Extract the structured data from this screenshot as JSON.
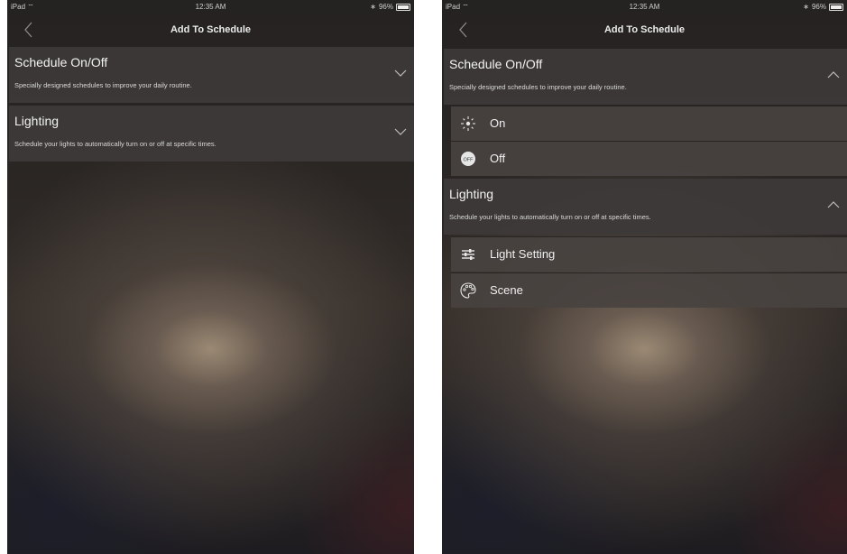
{
  "left": {
    "status": {
      "device": "iPad",
      "time": "12:35 AM",
      "battery": "96%"
    },
    "nav": {
      "title": "Add To Schedule"
    },
    "sections": [
      {
        "title": "Schedule On/Off",
        "description": "Specially designed schedules to improve your daily routine.",
        "expanded": false
      },
      {
        "title": "Lighting",
        "description": "Schedule your lights to automatically turn on or off at specific times.",
        "expanded": false
      }
    ]
  },
  "right": {
    "status": {
      "device": "iPad",
      "time": "12:35 AM",
      "battery": "96%"
    },
    "nav": {
      "title": "Add To Schedule"
    },
    "sections": [
      {
        "title": "Schedule On/Off",
        "description": "Specially designed schedules to improve your daily routine.",
        "expanded": true,
        "items": [
          {
            "label": "On",
            "icon": "sun-icon"
          },
          {
            "label": "Off",
            "icon": "off-badge-icon",
            "badge": "OFF"
          }
        ]
      },
      {
        "title": "Lighting",
        "description": "Schedule your lights to automatically turn on or off at specific times.",
        "expanded": true,
        "items": [
          {
            "label": "Light Setting",
            "icon": "sliders-icon"
          },
          {
            "label": "Scene",
            "icon": "palette-icon"
          }
        ]
      }
    ]
  },
  "colors": {
    "panel": "#3e3a3a",
    "subrow": "#484240",
    "text": "#f2f2f2"
  }
}
